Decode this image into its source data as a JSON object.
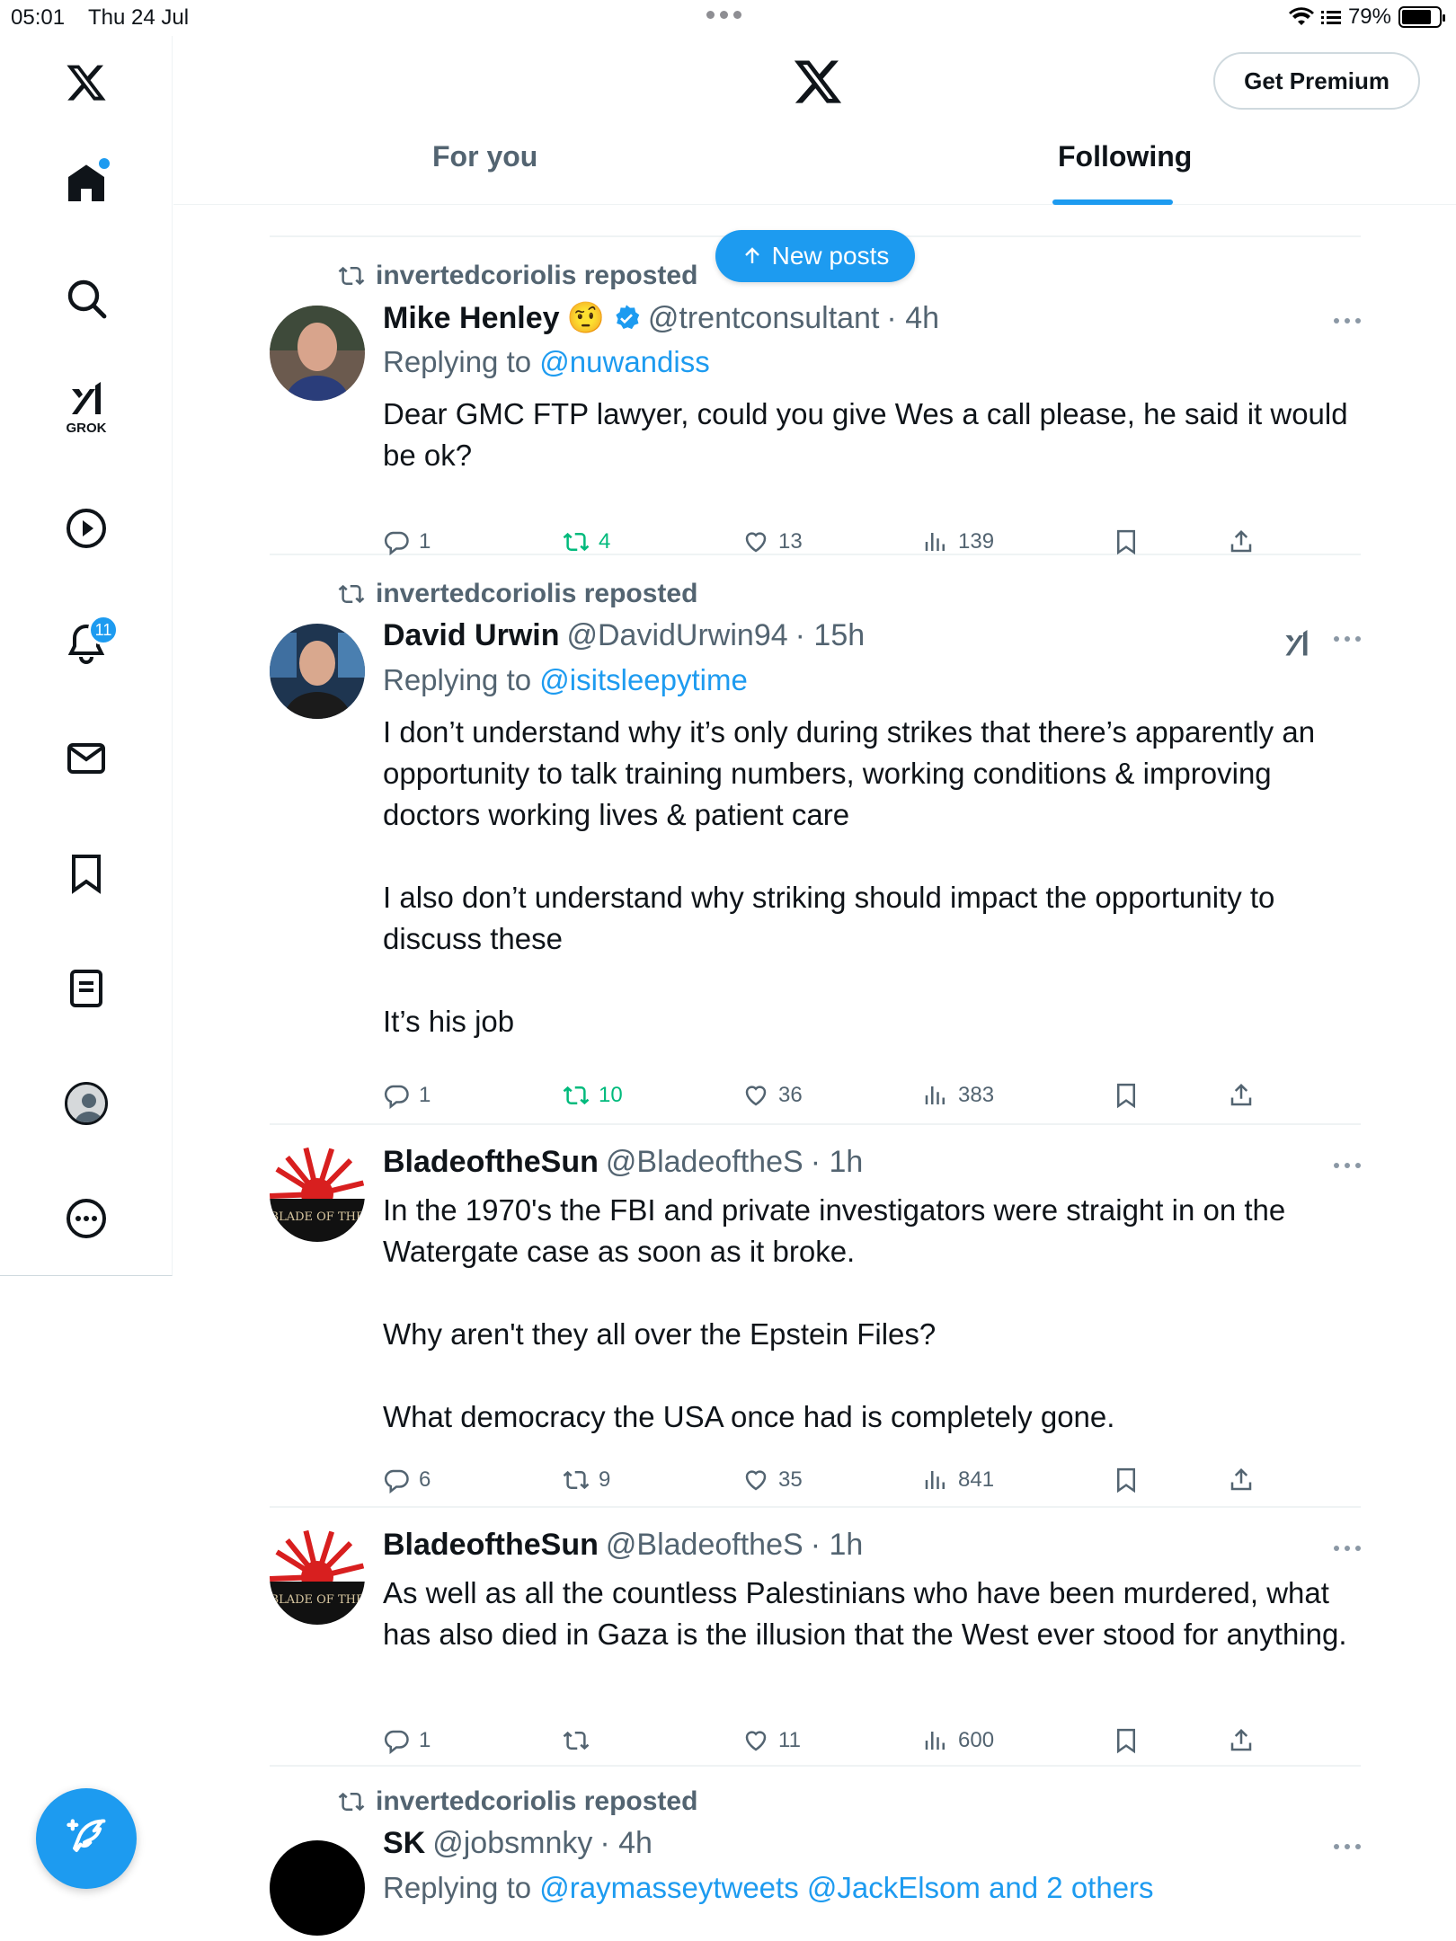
{
  "status_bar": {
    "time": "05:01",
    "date": "Thu 24 Jul",
    "battery": "79%"
  },
  "sidebar": {
    "notifications_badge": "11",
    "grok_label": "GROK"
  },
  "header": {
    "get_premium": "Get Premium",
    "tabs": [
      {
        "label": "For you"
      },
      {
        "label": "Following"
      }
    ]
  },
  "new_posts": {
    "label": "New posts"
  },
  "posts": [
    {
      "repost_label": "invertedcoriolis reposted",
      "name": "Mike Henley",
      "emoji": "🤨",
      "handle": "@trentconsultant",
      "time": "· 4h",
      "replying_prefix": "Replying to",
      "replying_to": "@nuwandiss",
      "text": "Dear GMC FTP lawyer, could you give Wes a call please, he said it would be ok?",
      "replies": "1",
      "reposts": "4",
      "likes": "13",
      "views": "139"
    },
    {
      "repost_label": "invertedcoriolis reposted",
      "name": "David Urwin",
      "handle": "@DavidUrwin94",
      "time": "· 15h",
      "replying_prefix": "Replying to",
      "replying_to": "@isitsleepytime",
      "text": "I don’t understand why it’s only during strikes that there’s apparently an opportunity to talk training numbers, working conditions & improving doctors working lives & patient care\n\nI also don’t understand why striking should impact the opportunity to discuss these\n\nIt’s his job",
      "replies": "1",
      "reposts": "10",
      "likes": "36",
      "views": "383"
    },
    {
      "name": "BladeoftheSun",
      "handle": "@BladeoftheS",
      "time": "· 1h",
      "avatar_text": "BLADE OF THE",
      "text": "In the 1970's the FBI and private investigators were straight in on the Watergate case as soon as it broke.\n\nWhy aren't they all over the Epstein Files?\n\nWhat democracy the USA once had is completely gone.",
      "replies": "6",
      "reposts": "9",
      "likes": "35",
      "views": "841"
    },
    {
      "name": "BladeoftheSun",
      "handle": "@BladeoftheS",
      "time": "· 1h",
      "avatar_text": "BLADE OF THE",
      "text": "As well as all the countless Palestinians who have been murdered, what has also died in Gaza is the illusion that the West ever stood for anything.",
      "replies": "1",
      "reposts": "",
      "likes": "11",
      "views": "600"
    },
    {
      "repost_label": "invertedcoriolis reposted",
      "name": "SK",
      "handle": "@jobsmnky",
      "time": "· 4h",
      "replying_prefix": "Replying to",
      "replying_to": "@raymasseytweets @JackElsom and 2 others"
    }
  ],
  "colors": {
    "accent": "#1d9bf0",
    "repost_green": "#00ba7c",
    "muted": "#536471",
    "text": "#0f1419"
  }
}
